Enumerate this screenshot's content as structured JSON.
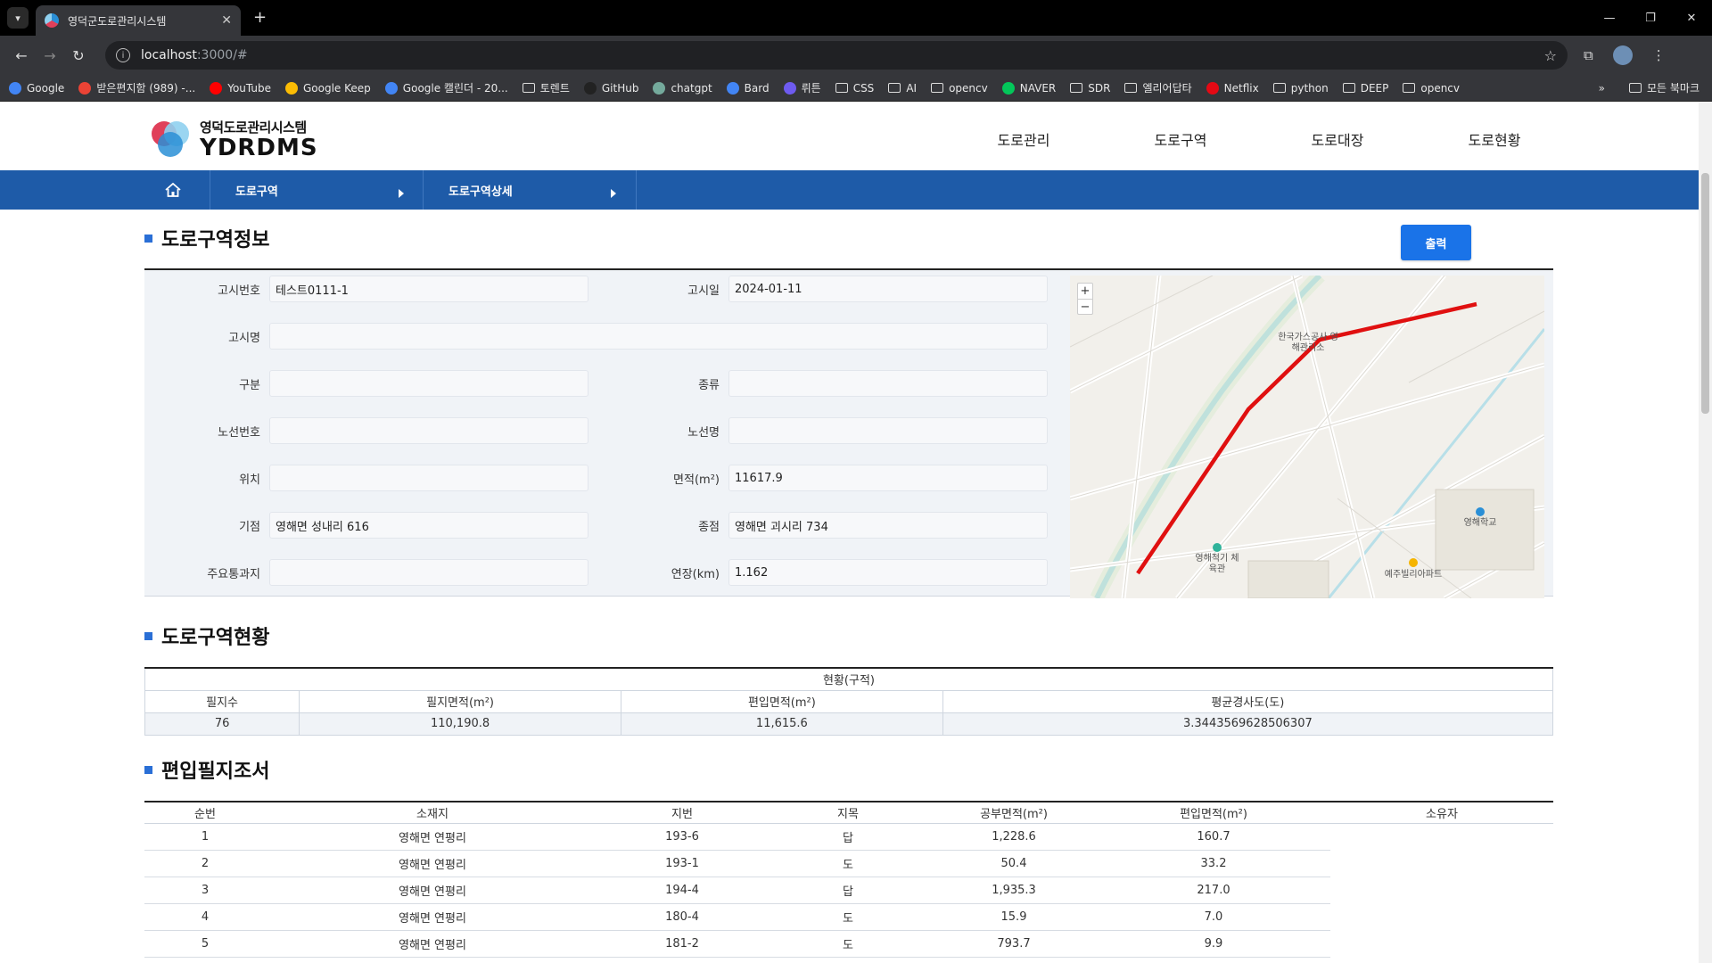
{
  "browser": {
    "tab_title": "영덕군도로관리시스템",
    "url_host": "localhost",
    "url_path": ":3000/#",
    "bookmarks": [
      {
        "label": "Google",
        "icon": "google-icon",
        "color": "#4285f4"
      },
      {
        "label": "받은편지함 (989) -...",
        "icon": "gmail-icon",
        "color": "#ea4335"
      },
      {
        "label": "YouTube",
        "icon": "youtube-icon",
        "color": "#ff0000"
      },
      {
        "label": "Google Keep",
        "icon": "keep-icon",
        "color": "#fbbc04"
      },
      {
        "label": "Google 캘린더 - 20...",
        "icon": "calendar-icon",
        "color": "#4285f4"
      },
      {
        "label": "토렌트",
        "icon": "folder-icon",
        "color": ""
      },
      {
        "label": "GitHub",
        "icon": "github-icon",
        "color": "#222222"
      },
      {
        "label": "chatgpt",
        "icon": "chatgpt-icon",
        "color": "#74aa9c"
      },
      {
        "label": "Bard",
        "icon": "bard-icon",
        "color": "#4285f4"
      },
      {
        "label": "뤼튼",
        "icon": "wrtn-icon",
        "color": "#6e5bf0"
      },
      {
        "label": "CSS",
        "icon": "folder-icon",
        "color": ""
      },
      {
        "label": "AI",
        "icon": "folder-icon",
        "color": ""
      },
      {
        "label": "opencv",
        "icon": "folder-icon",
        "color": ""
      },
      {
        "label": "NAVER",
        "icon": "naver-icon",
        "color": "#03c75a"
      },
      {
        "label": "SDR",
        "icon": "folder-icon",
        "color": ""
      },
      {
        "label": "엘리어답타",
        "icon": "folder-icon",
        "color": ""
      },
      {
        "label": "Netflix",
        "icon": "netflix-icon",
        "color": "#e50914"
      },
      {
        "label": "python",
        "icon": "folder-icon",
        "color": ""
      },
      {
        "label": "DEEP",
        "icon": "folder-icon",
        "color": ""
      },
      {
        "label": "opencv",
        "icon": "folder-icon",
        "color": ""
      }
    ],
    "all_bookmarks": "모든 북마크"
  },
  "site": {
    "logo_title": "영덕도로관리시스템",
    "logo_sub": "YDRDMS",
    "nav": [
      "도로관리",
      "도로구역",
      "도로대장",
      "도로현황"
    ]
  },
  "breadcrumb": [
    "도로구역",
    "도로구역상세"
  ],
  "info": {
    "title": "도로구역정보",
    "print_label": "출력",
    "fields": {
      "notice_no": {
        "label": "고시번호",
        "value": "테스트0111-1"
      },
      "notice_date": {
        "label": "고시일",
        "value": "2024-01-11"
      },
      "notice_name": {
        "label": "고시명",
        "value": ""
      },
      "division": {
        "label": "구분",
        "value": ""
      },
      "kind": {
        "label": "종류",
        "value": ""
      },
      "route_no": {
        "label": "노선번호",
        "value": ""
      },
      "route_name": {
        "label": "노선명",
        "value": ""
      },
      "location": {
        "label": "위치",
        "value": ""
      },
      "area": {
        "label": "면적(m²)",
        "value": "11617.9"
      },
      "start": {
        "label": "기점",
        "value": "영해면 성내리 616"
      },
      "end": {
        "label": "종점",
        "value": "영해면 괴시리 734"
      },
      "via": {
        "label": "주요통과지",
        "value": ""
      },
      "length": {
        "label": "연장(km)",
        "value": "1.162"
      }
    },
    "map": {
      "zoom_in": "+",
      "zoom_out": "−",
      "labels": [
        "한국가스공사 영해관리소",
        "영해학교",
        "영해적기 체육관",
        "예주빌리아파트"
      ],
      "route_color": "#e01010"
    }
  },
  "status": {
    "title": "도로구역현황",
    "group_header": "현황(구적)",
    "headers": [
      "필지수",
      "필지면적(m²)",
      "편입면적(m²)",
      "평균경사도(도)"
    ],
    "values": [
      "76",
      "110,190.8",
      "11,615.6",
      "3.3443569628506307"
    ]
  },
  "parcels": {
    "title": "편입필지조서",
    "headers": [
      "순번",
      "소재지",
      "지번",
      "지목",
      "공부면적(m²)",
      "편입면적(m²)",
      "소유자"
    ],
    "rows": [
      [
        "1",
        "영해면 연평리",
        "193-6",
        "답",
        "1,228.6",
        "160.7",
        ""
      ],
      [
        "2",
        "영해면 연평리",
        "193-1",
        "도",
        "50.4",
        "33.2",
        ""
      ],
      [
        "3",
        "영해면 연평리",
        "194-4",
        "답",
        "1,935.3",
        "217.0",
        ""
      ],
      [
        "4",
        "영해면 연평리",
        "180-4",
        "도",
        "15.9",
        "7.0",
        ""
      ],
      [
        "5",
        "영해면 연평리",
        "181-2",
        "도",
        "793.7",
        "9.9",
        ""
      ]
    ]
  }
}
